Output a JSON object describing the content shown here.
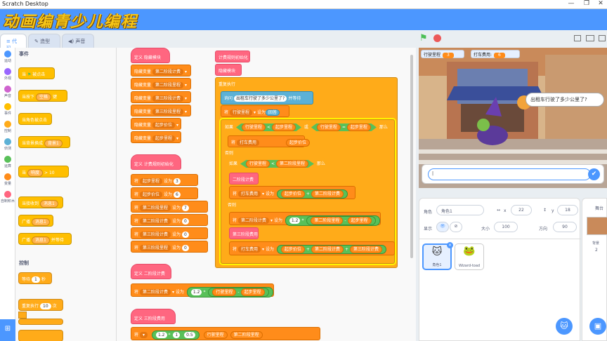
{
  "window": {
    "title": "Scratch Desktop",
    "controls": [
      "—",
      "❐",
      "✕"
    ]
  },
  "watermark": {
    "text": "动画编青少儿编程"
  },
  "tabs": [
    {
      "label": "代码",
      "icon": "code-icon"
    },
    {
      "label": "造型",
      "icon": "brush-icon"
    },
    {
      "label": "声音",
      "icon": "speaker-icon"
    }
  ],
  "categories": [
    {
      "label": "运动",
      "color": "#4c97ff"
    },
    {
      "label": "外观",
      "color": "#9966ff"
    },
    {
      "label": "声音",
      "color": "#cf63cf"
    },
    {
      "label": "事件",
      "color": "#ffbf00"
    },
    {
      "label": "控制",
      "color": "#ffab19"
    },
    {
      "label": "侦测",
      "color": "#5cb1d6"
    },
    {
      "label": "运算",
      "color": "#59c059"
    },
    {
      "label": "变量",
      "color": "#ff8c1a"
    },
    {
      "label": "自制积木",
      "color": "#ff6680"
    }
  ],
  "palette": {
    "events_title": "事件",
    "control_title": "控制",
    "event_blocks": [
      {
        "pre": "当",
        "post": "被点击"
      },
      {
        "pre": "当按下",
        "pill": "空格",
        "post": "键"
      },
      {
        "pre": "当角色被点击",
        "pill": "",
        "post": ""
      },
      {
        "pre": "当背景换成",
        "pill": "背景1",
        "post": ""
      },
      {
        "pre": "当",
        "pill": "响度",
        "post": "> 10"
      },
      {
        "pre": "当接收到",
        "pill": "消息1",
        "post": ""
      },
      {
        "pre": "广播",
        "pill": "消息1",
        "post": ""
      },
      {
        "pre": "广播",
        "pill": "消息1",
        "post": "并等待"
      }
    ],
    "control_blocks": [
      {
        "pre": "等待",
        "num": "1",
        "post": "秒"
      },
      {
        "pre": "重复执行",
        "num": "10",
        "post": "次"
      }
    ]
  },
  "code": {
    "hide_group": {
      "def": "定义 隐藏模块",
      "rows": [
        {
          "a": "隐藏变量",
          "b": "第二阶段计费"
        },
        {
          "a": "隐藏变量",
          "b": "第二阶段里程"
        },
        {
          "a": "隐藏变量",
          "b": "第三阶段计费"
        },
        {
          "a": "隐藏变量",
          "b": "第三阶段里程"
        },
        {
          "a": "隐藏变量",
          "b": "起步价位"
        },
        {
          "a": "隐藏变量",
          "b": "起步里程"
        }
      ]
    },
    "init_group": {
      "def": "定义 计费规则初始化",
      "rows": [
        {
          "a": "将",
          "b": "起步里程",
          "c": "设为",
          "v": "3"
        },
        {
          "a": "将",
          "b": "起步价位",
          "c": "设为",
          "v": "6"
        },
        {
          "a": "将",
          "b": "第二阶段里程",
          "c": "设为",
          "v": "7"
        },
        {
          "a": "将",
          "b": "第二阶段计费",
          "c": "设为",
          "v": "0"
        },
        {
          "a": "将",
          "b": "第三阶段计费",
          "c": "设为",
          "v": "0"
        },
        {
          "a": "将",
          "b": "第三阶段里程",
          "c": "设为",
          "v": "0"
        }
      ]
    },
    "stage2_group": {
      "def": "定义 二阶段计费",
      "set": "将",
      "var": "第二阶段计费",
      "to": "设为",
      "n": "1.2",
      "x": "行驶里程",
      "minus": "-",
      "y": "起步里程"
    },
    "stage3_group": {
      "def": "定义 三阶段费用",
      "set": "将",
      "n1": "1.2",
      "n2": "1",
      "n3": "0.5",
      "x": "行驶里程",
      "y": "第二阶段里程"
    },
    "main": {
      "b1": "计费规则初始化",
      "b2": "隐藏模块",
      "b3": "重复执行",
      "ask_label": "询问",
      "ask_text": "出租车行驶了多少公里了?",
      "ask_wait": "并等待",
      "set_label": "将",
      "set_var": "行驶里程",
      "set_to": "设为",
      "answer": "回答",
      "if1": "如果",
      "cmp1a": "行驶里程",
      "lt": "<",
      "cmp1b": "起步里程",
      "or": "或",
      "cmp1c": "行驶里程",
      "eq": "=",
      "cmp1d": "起步里程",
      "then": "那么",
      "set_fee": "将",
      "fee_var": "打车费用",
      "fee_short": "打车费用",
      "fee_val": "起步价位",
      "else1": "否则",
      "if2": "如果",
      "cmp2a": "行驶里程",
      "cmp2b": "第二阶段里程",
      "call2": "二阶段计费",
      "set2": "将",
      "fee2": "打车费用",
      "to2": "设为",
      "plus": "+",
      "sum2a": "起步价位",
      "sum2b": "第二阶段计费",
      "else2": "否则",
      "set3": "将",
      "var3": "第二阶段计费",
      "to3": "设为",
      "mul3": "1.2",
      "m3a": "第二阶段里程",
      "m3b": "起步里程",
      "call3": "第三阶段费用",
      "set4": "将",
      "fee4": "打车费用",
      "to4": "设为",
      "s4a": "起步价位",
      "s4b": "第二阶段计费",
      "s4c": "第三阶段计费"
    }
  },
  "zoom": {
    "in": "+",
    "out": "−",
    "reset": "="
  },
  "stage": {
    "monitor1": {
      "label": "行驶里程",
      "value": "3"
    },
    "monitor2": {
      "label": "打车费用:",
      "value": "6"
    },
    "bubble": "出租车行驶了多少公里了?",
    "ask_value": "|",
    "ok": "✔"
  },
  "sprite_info": {
    "sprite_label": "角色",
    "sprite_name": "角色1",
    "x_label": "x",
    "x": "22",
    "y_label": "y",
    "y": "18",
    "show_label": "显示",
    "size_label": "大小",
    "size": "100",
    "dir_label": "方向",
    "direction": "90"
  },
  "sprites": [
    {
      "name": "角色1",
      "selected": true
    },
    {
      "name": "Wizard-toad",
      "selected": false
    }
  ],
  "stage_pane": {
    "label": "舞台",
    "bg_label": "背景",
    "bg_count": "2"
  }
}
